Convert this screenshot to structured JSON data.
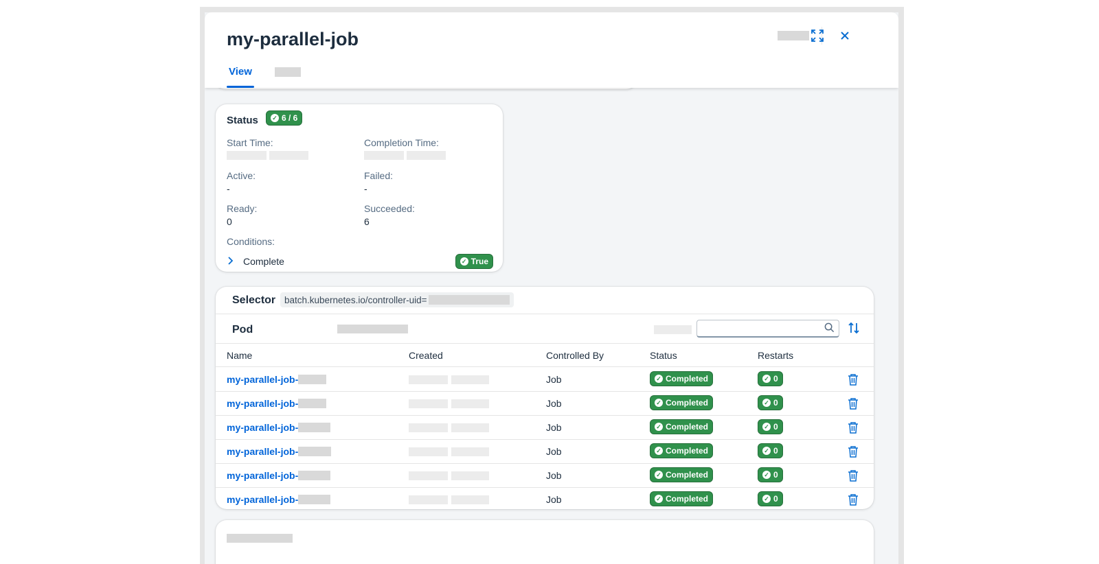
{
  "header": {
    "title": "my-parallel-job",
    "tabs": [
      {
        "label": "View"
      }
    ]
  },
  "status": {
    "title": "Status",
    "badge": "6 / 6",
    "fields": {
      "start_time_label": "Start Time:",
      "completion_time_label": "Completion Time:",
      "active_label": "Active:",
      "active_value": "-",
      "failed_label": "Failed:",
      "failed_value": "-",
      "ready_label": "Ready:",
      "ready_value": "0",
      "succeeded_label": "Succeeded:",
      "succeeded_value": "6",
      "conditions_label": "Conditions:"
    },
    "condition": {
      "label": "Complete",
      "badge": "True"
    }
  },
  "selector": {
    "label": "Selector",
    "value": "batch.kubernetes.io/controller-uid="
  },
  "pods": {
    "title": "Pod",
    "columns": [
      "Name",
      "Created",
      "Controlled By",
      "Status",
      "Restarts"
    ],
    "rows": [
      {
        "name": "my-parallel-job-",
        "controlled_by": "Job",
        "status": "Completed",
        "restarts": "0"
      },
      {
        "name": "my-parallel-job-",
        "controlled_by": "Job",
        "status": "Completed",
        "restarts": "0"
      },
      {
        "name": "my-parallel-job-",
        "controlled_by": "Job",
        "status": "Completed",
        "restarts": "0"
      },
      {
        "name": "my-parallel-job-",
        "controlled_by": "Job",
        "status": "Completed",
        "restarts": "0"
      },
      {
        "name": "my-parallel-job-",
        "controlled_by": "Job",
        "status": "Completed",
        "restarts": "0"
      },
      {
        "name": "my-parallel-job-",
        "controlled_by": "Job",
        "status": "Completed",
        "restarts": "0"
      }
    ]
  },
  "colors": {
    "accent": "#0064d9",
    "success": "#30914c",
    "background": "#f3f5f7"
  },
  "icons": [
    "expand-icon",
    "close-icon",
    "search-icon",
    "sort-icon",
    "chevron-right-icon",
    "check-circle-icon",
    "delete-icon"
  ]
}
